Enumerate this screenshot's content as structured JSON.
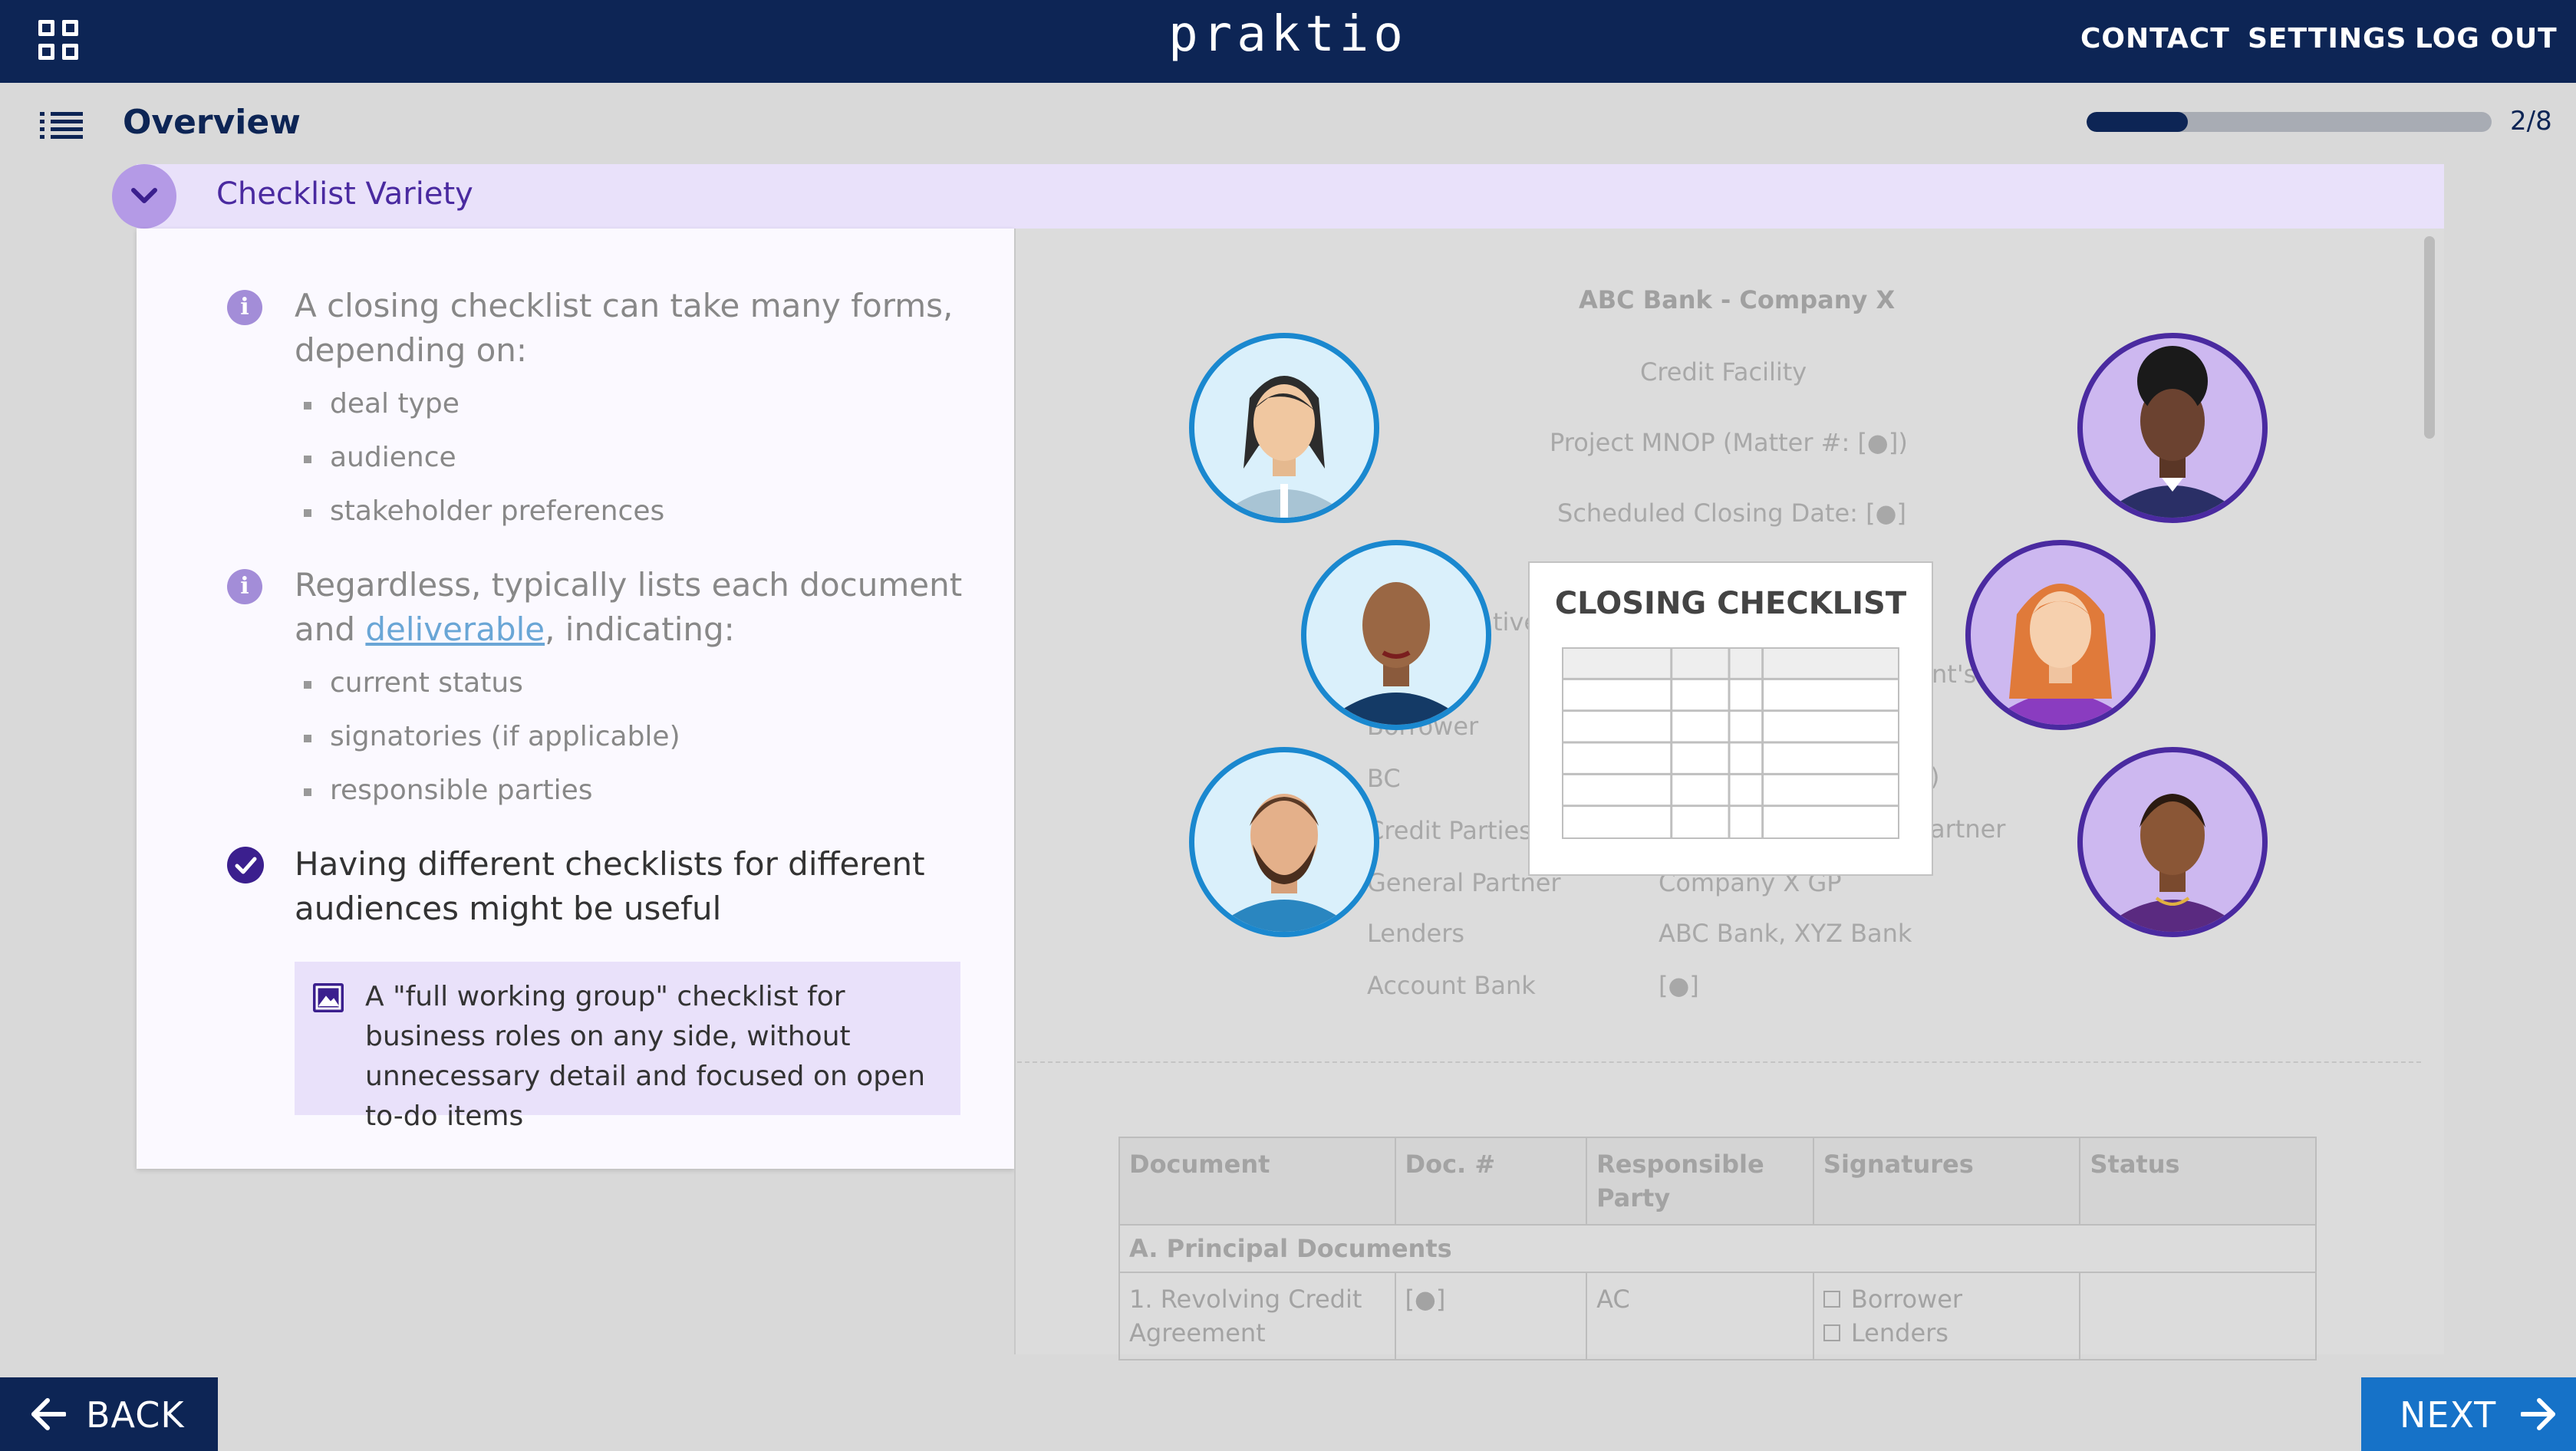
{
  "header": {
    "brand": "praktio",
    "nav": [
      "CONTACT",
      "SETTINGS",
      "LOG OUT"
    ]
  },
  "overview": {
    "title": "Overview",
    "progress_text": "2/8",
    "progress_fraction": 0.25
  },
  "section": {
    "title": "Checklist Variety"
  },
  "content": {
    "point1": {
      "text": "A closing checklist can take many forms, depending on:",
      "bullets": [
        "deal type",
        "audience",
        "stakeholder preferences"
      ]
    },
    "point2": {
      "text_before": "Regardless, typically lists each document and",
      "link": "deliverable",
      "text_after": ", indicating:",
      "bullets": [
        "current status",
        "signatories (if applicable)",
        "responsible parties"
      ]
    },
    "point3": {
      "text": "Having different checklists for different audiences might be useful"
    },
    "note": "A \"full working group\" checklist for business roles on any side, without unnecessary detail and focused on open to-do items"
  },
  "document": {
    "title": "ABC Bank - Company X",
    "subtitle": "Credit Facility",
    "project": "Project MNOP (Matter #: [●])",
    "closing_date": "Scheduled Closing Date: [●]",
    "frag_tive": "tive",
    "frag_nts": "nt's",
    "frag_paren": ")",
    "frag_artner": "artner",
    "parties": [
      {
        "label": "Borrower",
        "value": ""
      },
      {
        "label": "BC",
        "value": ""
      },
      {
        "label": "Credit Parties",
        "value": ""
      },
      {
        "label": "General Partner",
        "value": "Company X GP"
      },
      {
        "label": "Lenders",
        "value": "ABC Bank, XYZ Bank"
      },
      {
        "label": "Account Bank",
        "value": "[●]"
      }
    ],
    "closing_card_title": "CLOSING CHECKLIST",
    "table": {
      "headers": [
        "Document",
        "Doc. #",
        "Responsible Party",
        "Signatures",
        "Status"
      ],
      "group": "A. Principal Documents",
      "row": {
        "document": "1. Revolving Credit Agreement",
        "doc_no": "[●]",
        "party": "AC",
        "signatures": [
          "Borrower",
          "Lenders"
        ],
        "status": ""
      }
    }
  },
  "footer": {
    "back": "BACK",
    "next": "NEXT"
  },
  "colors": {
    "navy": "#0d2555",
    "purple": "#3b1f8e",
    "lavender": "#e9e1fa",
    "next_blue": "#1672c8"
  }
}
